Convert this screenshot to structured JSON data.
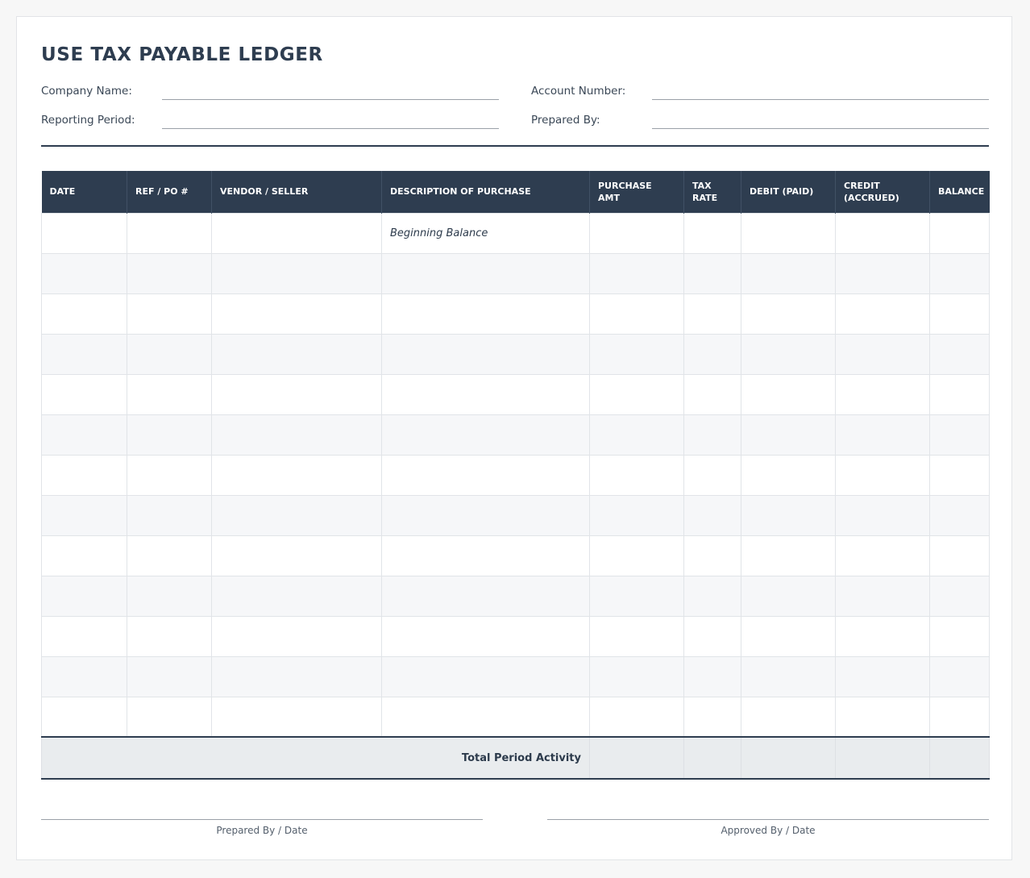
{
  "document": {
    "title": "USE TAX PAYABLE LEDGER"
  },
  "header_fields": {
    "company_name": "Company Name:",
    "account_number": "Account Number:",
    "reporting_period": "Reporting Period:",
    "prepared_by": "Prepared By:"
  },
  "table": {
    "columns": [
      "DATE",
      "REF / PO #",
      "VENDOR / SELLER",
      "DESCRIPTION OF PURCHASE",
      "PURCHASE AMT",
      "TAX RATE",
      "DEBIT (PAID)",
      "CREDIT (ACCRUED)",
      "BALANCE"
    ],
    "first_row_description": "Beginning Balance",
    "total_label": "Total Period Activity"
  },
  "signatures": {
    "prepared": "Prepared By / Date",
    "approved": "Approved By / Date"
  }
}
